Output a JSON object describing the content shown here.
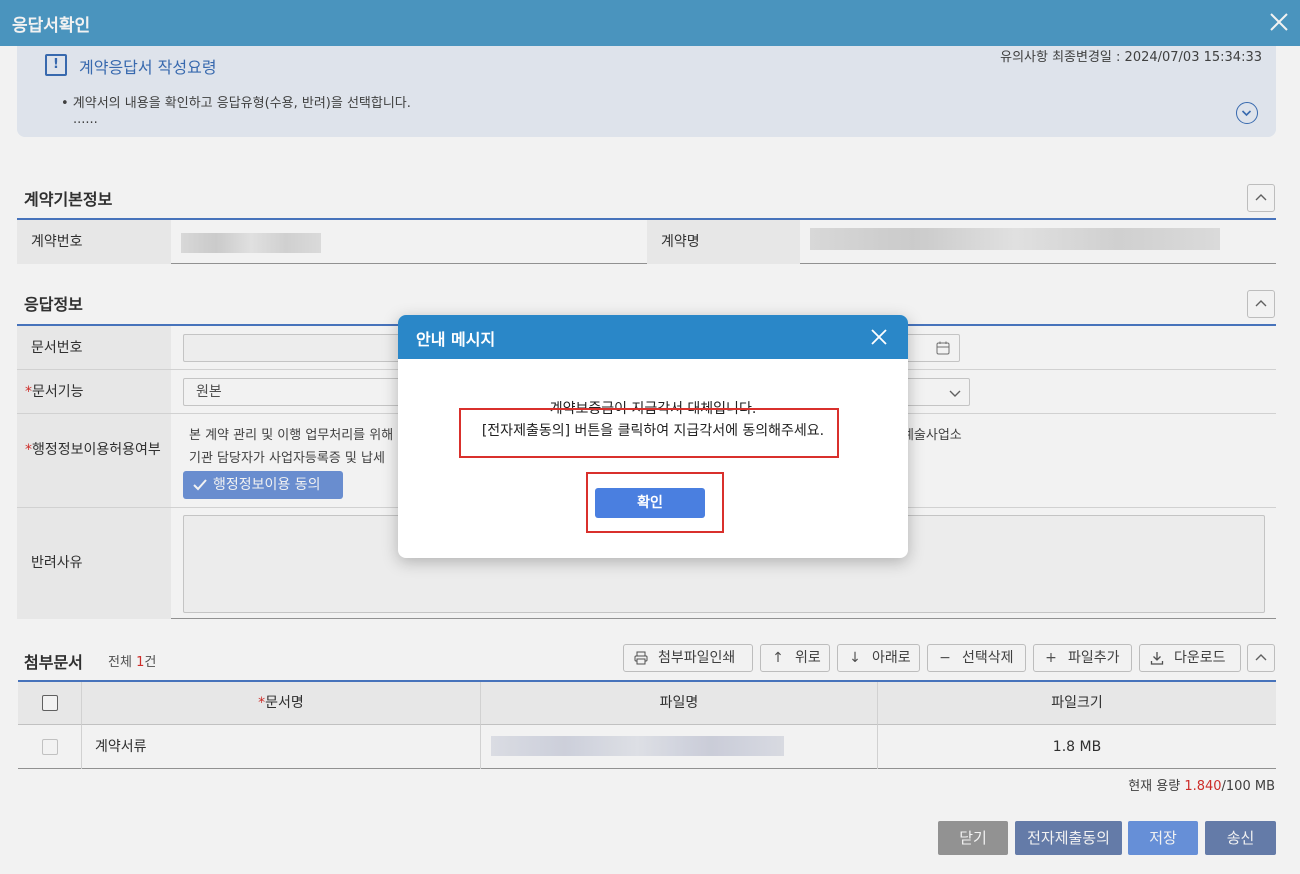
{
  "window": {
    "title": "응답서확인"
  },
  "guide": {
    "title": "계약응답서 작성요령",
    "last_modified": "유의사항 최종변경일 : 2024/07/03 15:34:33",
    "line1": "• 계약서의 내용을 확인하고 응답유형(수용, 반려)을 선택합니다.",
    "line2": "......"
  },
  "basic_info": {
    "title": "계약기본정보",
    "contract_no_label": "계약번호",
    "contract_name_label": "계약명"
  },
  "response_info": {
    "title": "응답정보",
    "doc_no_label": "문서번호",
    "doc_function_label": "문서기능",
    "doc_function_value": "원본",
    "admin_info_label": "행정정보이용허용여부",
    "admin_text1": "본 계약 관리 및 이행 업무처리를 위해",
    "admin_text1_tail": "화예술사업소",
    "admin_text2": "기관 담당자가 사업자등록증 및 납세",
    "admin_consent_btn": "행정정보이용 동의",
    "reject_reason_label": "반려사유"
  },
  "attachments": {
    "title": "첨부문서",
    "count_prefix": "전체",
    "count": "1",
    "count_suffix": "건",
    "buttons": {
      "print": "첨부파일인쇄",
      "up": "위로",
      "down": "아래로",
      "delete": "선택삭제",
      "add": "파일추가",
      "download": "다운로드"
    },
    "columns": {
      "doc_name": "문서명",
      "file_name": "파일명",
      "file_size": "파일크기"
    },
    "rows": [
      {
        "doc_name": "계약서류",
        "file_size": "1.8 MB"
      }
    ],
    "capacity_label": "현재 용량",
    "capacity_used": "1.840",
    "capacity_total": "/100 MB"
  },
  "footer": {
    "close": "닫기",
    "e_submit": "전자제출동의",
    "save": "저장",
    "send": "송신"
  },
  "dialog": {
    "title": "안내 메시지",
    "message1": "계약보증금이 지급각서 대체입니다.",
    "message2": "[전자제출동의] 버튼을 클릭하여 지급각서에 동의해주세요.",
    "ok": "확인"
  }
}
